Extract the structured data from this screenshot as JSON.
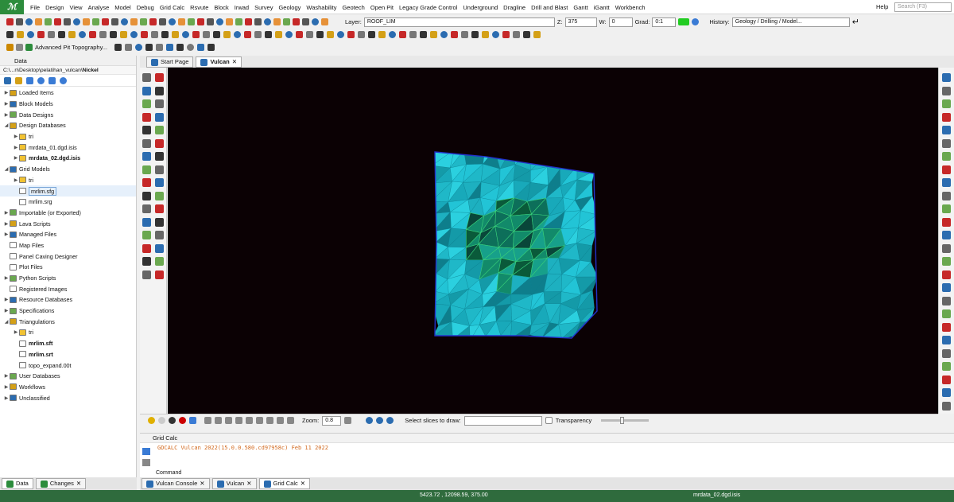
{
  "menu": {
    "logo": "ℳ",
    "items": [
      "File",
      "Design",
      "View",
      "Analyse",
      "Model",
      "Debug",
      "Grid Calc",
      "Rsvute",
      "Block",
      "Irwad",
      "Survey",
      "Geology",
      "Washability",
      "Geotech",
      "Open Pit",
      "Legacy Grade Control",
      "Underground",
      "Dragline",
      "Drill and Blast",
      "Gantt",
      "iGantt",
      "Workbench"
    ],
    "help": "Help",
    "search_placeholder": "Search (F3)"
  },
  "toolbar": {
    "layer_label": "Layer:",
    "layer_value": "ROOF_LIM",
    "z_label": "Z:",
    "z_value": "375",
    "w_label": "W:",
    "w_value": "0",
    "grad_label": "Grad:",
    "grad_value": "0:1",
    "history_label": "History:",
    "history_value": "Geology / Drilling / Model...",
    "adv_pit": "Advanced Pit Topography..."
  },
  "data_panel": {
    "title": "Data",
    "path_prefix": "C:\\...n\\Desktop\\pelatihan_vulcan\\",
    "path_bold": "Nickel",
    "tree": [
      {
        "label": "Loaded Items",
        "level": 0,
        "arrow": "▶",
        "bold": false
      },
      {
        "label": "Block Models",
        "level": 0,
        "arrow": "▶",
        "bold": false
      },
      {
        "label": "Data Designs",
        "level": 0,
        "arrow": "▶",
        "bold": false
      },
      {
        "label": "Design Databases",
        "level": 0,
        "arrow": "◢",
        "bold": false
      },
      {
        "label": "tri",
        "level": 1,
        "arrow": "▶",
        "bold": false
      },
      {
        "label": "mrdata_01.dgd.isis",
        "level": 1,
        "arrow": "▶",
        "bold": false
      },
      {
        "label": "mrdata_02.dgd.isis",
        "level": 1,
        "arrow": "▶",
        "bold": true
      },
      {
        "label": "Grid Models",
        "level": 0,
        "arrow": "◢",
        "bold": false
      },
      {
        "label": "tri",
        "level": 1,
        "arrow": "▶",
        "bold": false
      },
      {
        "label": "mrlim.sfg",
        "level": 1,
        "arrow": "",
        "bold": false,
        "selected": true
      },
      {
        "label": "mrlim.srg",
        "level": 1,
        "arrow": "",
        "bold": false
      },
      {
        "label": "Importable (or Exported)",
        "level": 0,
        "arrow": "▶",
        "bold": false
      },
      {
        "label": "Lava Scripts",
        "level": 0,
        "arrow": "▶",
        "bold": false
      },
      {
        "label": "Managed Files",
        "level": 0,
        "arrow": "▶",
        "bold": false
      },
      {
        "label": "Map Files",
        "level": 0,
        "arrow": "",
        "bold": false
      },
      {
        "label": "Panel Caving Designer",
        "level": 0,
        "arrow": "",
        "bold": false
      },
      {
        "label": "Plot Files",
        "level": 0,
        "arrow": "",
        "bold": false
      },
      {
        "label": "Python Scripts",
        "level": 0,
        "arrow": "▶",
        "bold": false
      },
      {
        "label": "Registered Images",
        "level": 0,
        "arrow": "",
        "bold": false
      },
      {
        "label": "Resource Databases",
        "level": 0,
        "arrow": "▶",
        "bold": false
      },
      {
        "label": "Specifications",
        "level": 0,
        "arrow": "▶",
        "bold": false
      },
      {
        "label": "Triangulations",
        "level": 0,
        "arrow": "◢",
        "bold": false
      },
      {
        "label": "tri",
        "level": 1,
        "arrow": "▶",
        "bold": false
      },
      {
        "label": "mrlim.sft",
        "level": 1,
        "arrow": "",
        "bold": true
      },
      {
        "label": "mrlim.srt",
        "level": 1,
        "arrow": "",
        "bold": true
      },
      {
        "label": "topo_expand.00t",
        "level": 1,
        "arrow": "",
        "bold": false
      },
      {
        "label": "User Databases",
        "level": 0,
        "arrow": "▶",
        "bold": false
      },
      {
        "label": "Workflows",
        "level": 0,
        "arrow": "▶",
        "bold": false
      },
      {
        "label": "Unclassified",
        "level": 0,
        "arrow": "▶",
        "bold": false
      }
    ]
  },
  "left_bottom_tabs": [
    "Data",
    "Changes"
  ],
  "doc_tabs": [
    "Start Page",
    "Vulcan"
  ],
  "view_bar": {
    "zoom_label": "Zoom:",
    "zoom_value": "0.8",
    "slices_label": "Select slices to draw:",
    "transparency_label": "Transparency"
  },
  "console": {
    "title": "Grid Calc",
    "output": "GDCALC Vulcan 2022(15.0.0.580.cd97958c) Feb 11 2022",
    "command_label": "Command"
  },
  "bottom_tabs": [
    "Vulcan Console",
    "Vulcan",
    "Grid Calc"
  ],
  "status": {
    "coords": "5423.72 , 12098.59, 375.00",
    "file": "mrdata_02.dgd.isis"
  },
  "colors": {
    "accent_green": "#2f6b3d",
    "surface_cyan": "#1fb8c8",
    "viewport_bg": "#0b0104"
  }
}
